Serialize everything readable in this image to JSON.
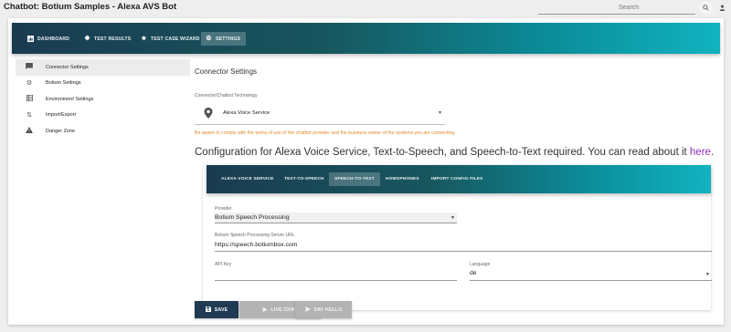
{
  "header": {
    "title": "Chatbot: Botium Samples - Alexa AVS Bot",
    "search_placeholder": "Search"
  },
  "nav": {
    "items": [
      {
        "label": "DASHBOARD",
        "icon": "chart-icon"
      },
      {
        "label": "TEST RESULTS",
        "icon": "bug-icon"
      },
      {
        "label": "TEST CASE WIZARD",
        "icon": "star-icon"
      },
      {
        "label": "SETTINGS",
        "icon": "gear-icon"
      }
    ],
    "active": "SETTINGS"
  },
  "sidebar": {
    "items": [
      {
        "label": "Connector Settings",
        "icon": "chat-icon"
      },
      {
        "label": "Botium Settings",
        "icon": "gear-icon"
      },
      {
        "label": "Environment Settings",
        "icon": "grid-icon"
      },
      {
        "label": "Import/Export",
        "icon": "swap-icon"
      },
      {
        "label": "Danger Zone",
        "icon": "warning-icon"
      }
    ],
    "active": "Connector Settings"
  },
  "connector": {
    "heading": "Connector Settings",
    "tech_label": "Connector/Chatbot Technology",
    "tech_value": "Alexa Voice Service",
    "warning": "Be aware to comply with the terms of use of the chatbot provider and the business owner of the systems you are connecting.",
    "config_heading": "Configuration for Alexa Voice Service, Text-to-Speech, and Speech-to-Text required. You can read about it",
    "config_link": "here",
    "config_end": "."
  },
  "tabs": {
    "items": [
      "ALEXA VOICE SERVICE",
      "TEXT-TO-SPEECH",
      "SPEECH-TO-TEXT",
      "HOMOPHONES",
      "IMPORT CONFIG FILES"
    ],
    "active": "SPEECH-TO-TEXT"
  },
  "form": {
    "provider_label": "Provider",
    "provider_value": "Botium Speech Processing",
    "url_label": "Botium Speech Processing Server URL",
    "url_value": "https://speech.botiumbox.com",
    "apikey_label": "API Key",
    "apikey_value": "",
    "language_label": "Language",
    "language_value": "de"
  },
  "buttons": {
    "save": "SAVE",
    "live_chat": "LIVE CHAT",
    "say_hello": "SAY HELLO"
  },
  "colors": {
    "navbar_start": "#1a3b50",
    "navbar_end": "#11b3c0",
    "save_button": "#1f3a52",
    "warning_text": "#e08a2a",
    "link": "#8e2fb5"
  }
}
